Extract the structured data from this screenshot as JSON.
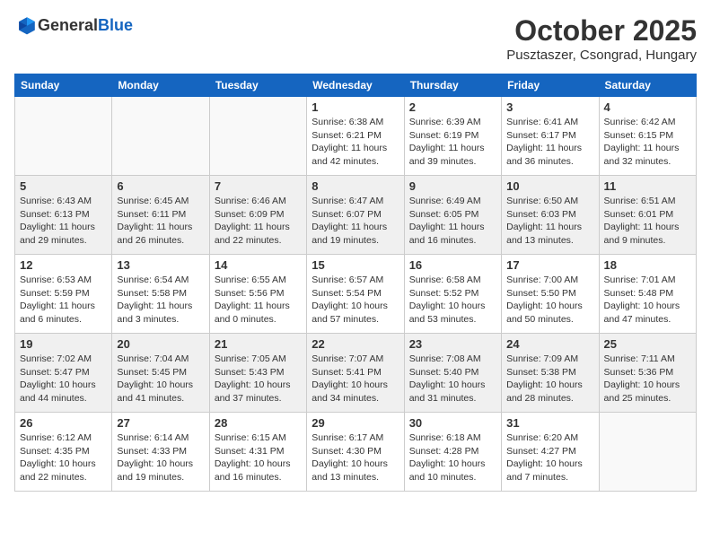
{
  "header": {
    "logo_general": "General",
    "logo_blue": "Blue",
    "month": "October 2025",
    "location": "Pusztaszer, Csongrad, Hungary"
  },
  "weekdays": [
    "Sunday",
    "Monday",
    "Tuesday",
    "Wednesday",
    "Thursday",
    "Friday",
    "Saturday"
  ],
  "weeks": [
    [
      {
        "day": "",
        "info": ""
      },
      {
        "day": "",
        "info": ""
      },
      {
        "day": "",
        "info": ""
      },
      {
        "day": "1",
        "info": "Sunrise: 6:38 AM\nSunset: 6:21 PM\nDaylight: 11 hours\nand 42 minutes."
      },
      {
        "day": "2",
        "info": "Sunrise: 6:39 AM\nSunset: 6:19 PM\nDaylight: 11 hours\nand 39 minutes."
      },
      {
        "day": "3",
        "info": "Sunrise: 6:41 AM\nSunset: 6:17 PM\nDaylight: 11 hours\nand 36 minutes."
      },
      {
        "day": "4",
        "info": "Sunrise: 6:42 AM\nSunset: 6:15 PM\nDaylight: 11 hours\nand 32 minutes."
      }
    ],
    [
      {
        "day": "5",
        "info": "Sunrise: 6:43 AM\nSunset: 6:13 PM\nDaylight: 11 hours\nand 29 minutes."
      },
      {
        "day": "6",
        "info": "Sunrise: 6:45 AM\nSunset: 6:11 PM\nDaylight: 11 hours\nand 26 minutes."
      },
      {
        "day": "7",
        "info": "Sunrise: 6:46 AM\nSunset: 6:09 PM\nDaylight: 11 hours\nand 22 minutes."
      },
      {
        "day": "8",
        "info": "Sunrise: 6:47 AM\nSunset: 6:07 PM\nDaylight: 11 hours\nand 19 minutes."
      },
      {
        "day": "9",
        "info": "Sunrise: 6:49 AM\nSunset: 6:05 PM\nDaylight: 11 hours\nand 16 minutes."
      },
      {
        "day": "10",
        "info": "Sunrise: 6:50 AM\nSunset: 6:03 PM\nDaylight: 11 hours\nand 13 minutes."
      },
      {
        "day": "11",
        "info": "Sunrise: 6:51 AM\nSunset: 6:01 PM\nDaylight: 11 hours\nand 9 minutes."
      }
    ],
    [
      {
        "day": "12",
        "info": "Sunrise: 6:53 AM\nSunset: 5:59 PM\nDaylight: 11 hours\nand 6 minutes."
      },
      {
        "day": "13",
        "info": "Sunrise: 6:54 AM\nSunset: 5:58 PM\nDaylight: 11 hours\nand 3 minutes."
      },
      {
        "day": "14",
        "info": "Sunrise: 6:55 AM\nSunset: 5:56 PM\nDaylight: 11 hours\nand 0 minutes."
      },
      {
        "day": "15",
        "info": "Sunrise: 6:57 AM\nSunset: 5:54 PM\nDaylight: 10 hours\nand 57 minutes."
      },
      {
        "day": "16",
        "info": "Sunrise: 6:58 AM\nSunset: 5:52 PM\nDaylight: 10 hours\nand 53 minutes."
      },
      {
        "day": "17",
        "info": "Sunrise: 7:00 AM\nSunset: 5:50 PM\nDaylight: 10 hours\nand 50 minutes."
      },
      {
        "day": "18",
        "info": "Sunrise: 7:01 AM\nSunset: 5:48 PM\nDaylight: 10 hours\nand 47 minutes."
      }
    ],
    [
      {
        "day": "19",
        "info": "Sunrise: 7:02 AM\nSunset: 5:47 PM\nDaylight: 10 hours\nand 44 minutes."
      },
      {
        "day": "20",
        "info": "Sunrise: 7:04 AM\nSunset: 5:45 PM\nDaylight: 10 hours\nand 41 minutes."
      },
      {
        "day": "21",
        "info": "Sunrise: 7:05 AM\nSunset: 5:43 PM\nDaylight: 10 hours\nand 37 minutes."
      },
      {
        "day": "22",
        "info": "Sunrise: 7:07 AM\nSunset: 5:41 PM\nDaylight: 10 hours\nand 34 minutes."
      },
      {
        "day": "23",
        "info": "Sunrise: 7:08 AM\nSunset: 5:40 PM\nDaylight: 10 hours\nand 31 minutes."
      },
      {
        "day": "24",
        "info": "Sunrise: 7:09 AM\nSunset: 5:38 PM\nDaylight: 10 hours\nand 28 minutes."
      },
      {
        "day": "25",
        "info": "Sunrise: 7:11 AM\nSunset: 5:36 PM\nDaylight: 10 hours\nand 25 minutes."
      }
    ],
    [
      {
        "day": "26",
        "info": "Sunrise: 6:12 AM\nSunset: 4:35 PM\nDaylight: 10 hours\nand 22 minutes."
      },
      {
        "day": "27",
        "info": "Sunrise: 6:14 AM\nSunset: 4:33 PM\nDaylight: 10 hours\nand 19 minutes."
      },
      {
        "day": "28",
        "info": "Sunrise: 6:15 AM\nSunset: 4:31 PM\nDaylight: 10 hours\nand 16 minutes."
      },
      {
        "day": "29",
        "info": "Sunrise: 6:17 AM\nSunset: 4:30 PM\nDaylight: 10 hours\nand 13 minutes."
      },
      {
        "day": "30",
        "info": "Sunrise: 6:18 AM\nSunset: 4:28 PM\nDaylight: 10 hours\nand 10 minutes."
      },
      {
        "day": "31",
        "info": "Sunrise: 6:20 AM\nSunset: 4:27 PM\nDaylight: 10 hours\nand 7 minutes."
      },
      {
        "day": "",
        "info": ""
      }
    ]
  ]
}
